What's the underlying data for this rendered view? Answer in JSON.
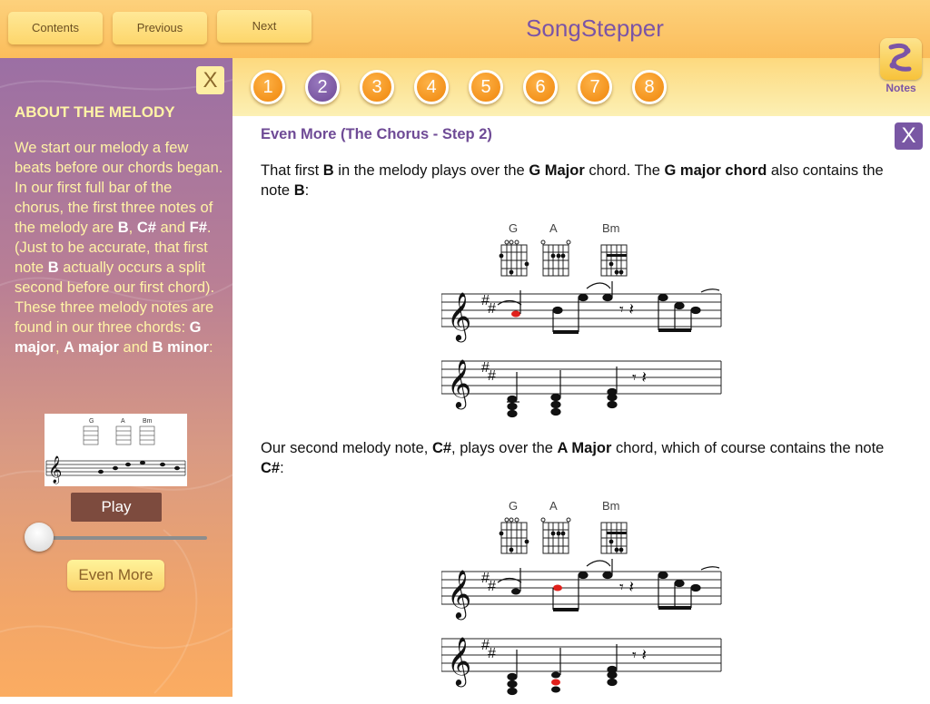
{
  "topbar": {
    "contents_label": "Contents",
    "previous_label": "Previous",
    "next_label": "Next",
    "app_title": "SongStepper"
  },
  "sidebar": {
    "close_label": "X",
    "heading": "ABOUT THE MELODY",
    "body_parts": [
      {
        "t": "We start our melody a few beats before our chords began. In our first full bar of the chorus, the first three notes of the melody are ",
        "b": false
      },
      {
        "t": "B",
        "b": true
      },
      {
        "t": ", ",
        "b": false
      },
      {
        "t": "C#",
        "b": true
      },
      {
        "t": " and ",
        "b": false
      },
      {
        "t": "F#",
        "b": true
      },
      {
        "t": ". (Just to be accurate, that first note ",
        "b": false
      },
      {
        "t": "B",
        "b": true
      },
      {
        "t": " actually occurs a split second before our first chord). These three melody notes are found in our three chords: ",
        "b": false
      },
      {
        "t": "G major",
        "b": true
      },
      {
        "t": ", ",
        "b": false
      },
      {
        "t": "A major",
        "b": true
      },
      {
        "t": " and ",
        "b": false
      },
      {
        "t": "B minor",
        "b": true
      },
      {
        "t": ":",
        "b": false
      }
    ],
    "play_label": "Play",
    "playback_position": 0,
    "even_more_label": "Even More"
  },
  "steps": [
    "1",
    "2",
    "3",
    "4",
    "5",
    "6",
    "7",
    "8"
  ],
  "active_step": "2",
  "notes_label": "Notes",
  "content": {
    "title": "Even More (The Chorus - Step 2)",
    "close_label": "X",
    "para1_parts": [
      {
        "t": "That first ",
        "b": false
      },
      {
        "t": "B",
        "b": true
      },
      {
        "t": " in the melody plays over the ",
        "b": false
      },
      {
        "t": "G Major",
        "b": true
      },
      {
        "t": " chord. The ",
        "b": false
      },
      {
        "t": "G major chord",
        "b": true
      },
      {
        "t": " also contains the note ",
        "b": false
      },
      {
        "t": "B",
        "b": true
      },
      {
        "t": ":",
        "b": false
      }
    ],
    "para2_parts": [
      {
        "t": "Our second melody note, ",
        "b": false
      },
      {
        "t": "C#",
        "b": true
      },
      {
        "t": ", plays over the ",
        "b": false
      },
      {
        "t": "A Major",
        "b": true
      },
      {
        "t": " chord, which of course contains the note ",
        "b": false
      },
      {
        "t": "C#",
        "b": true
      },
      {
        "t": ":",
        "b": false
      }
    ],
    "chord_names": [
      "G",
      "A",
      "Bm"
    ]
  },
  "colors": {
    "accent_purple": "#7b54a6",
    "step_orange": "#f39418",
    "highlight_note": "#e0201b"
  }
}
